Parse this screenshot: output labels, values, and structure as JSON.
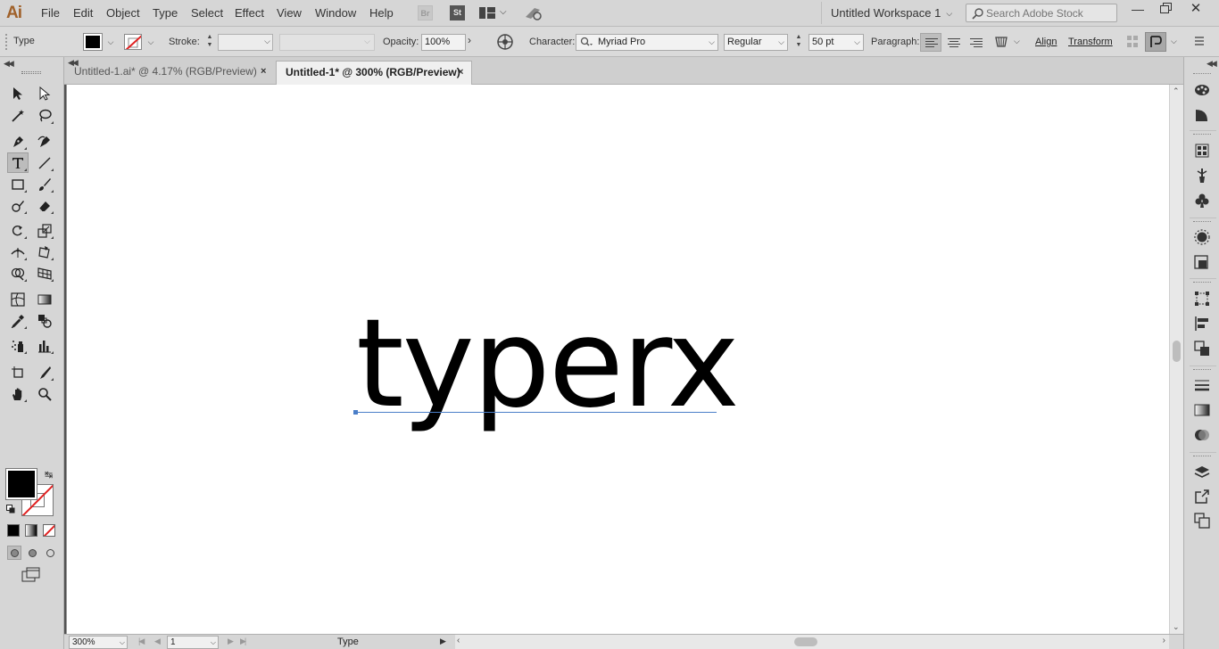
{
  "app": {
    "logo": "Ai"
  },
  "menu": [
    "File",
    "Edit",
    "Object",
    "Type",
    "Select",
    "Effect",
    "View",
    "Window",
    "Help"
  ],
  "menubar": {
    "bridge_label": "Br",
    "stock_label": "St",
    "workspace": "Untitled Workspace 1",
    "search_placeholder": "Search Adobe Stock"
  },
  "controlbar": {
    "tool_name": "Type",
    "stroke_label": "Stroke:",
    "opacity_label": "Opacity:",
    "opacity_value": "100%",
    "character_label": "Character:",
    "font_family": "Myriad Pro",
    "font_style": "Regular",
    "font_size": "50 pt",
    "paragraph_label": "Paragraph:",
    "align_label": "Align",
    "transform_label": "Transform",
    "fill_color": "#000000",
    "stroke_color": "none"
  },
  "tabs": [
    {
      "label": "Untitled-1.ai* @ 4.17% (RGB/Preview)",
      "active": false
    },
    {
      "label": "Untitled-1* @ 300% (RGB/Preview)",
      "active": true
    }
  ],
  "canvas": {
    "text": "typerx"
  },
  "statusbar": {
    "zoom": "300%",
    "artboard": "1",
    "status": "Type"
  },
  "tools": [
    "selection-tool",
    "direct-selection-tool",
    "magic-wand-tool",
    "lasso-tool",
    "pen-tool",
    "curvature-tool",
    "type-tool",
    "line-segment-tool",
    "rectangle-tool",
    "paintbrush-tool",
    "shaper-tool",
    "eraser-tool",
    "rotate-tool",
    "scale-tool",
    "width-tool",
    "free-transform-tool",
    "shape-builder-tool",
    "perspective-grid-tool",
    "mesh-tool",
    "gradient-tool",
    "eyedropper-tool",
    "blend-tool",
    "symbol-sprayer-tool",
    "column-graph-tool",
    "artboard-tool",
    "slice-tool",
    "hand-tool",
    "zoom-tool"
  ],
  "dock_icons": [
    "color-guide-icon",
    "color-icon",
    "swatches-icon",
    "brushes-icon",
    "symbols-icon",
    "appearance-icon",
    "graphic-styles-icon",
    "transform-icon",
    "align-icon",
    "pathfinder-icon",
    "stroke-icon",
    "gradient-icon",
    "transparency-icon",
    "layers-icon",
    "export-icon",
    "artboards-icon"
  ]
}
